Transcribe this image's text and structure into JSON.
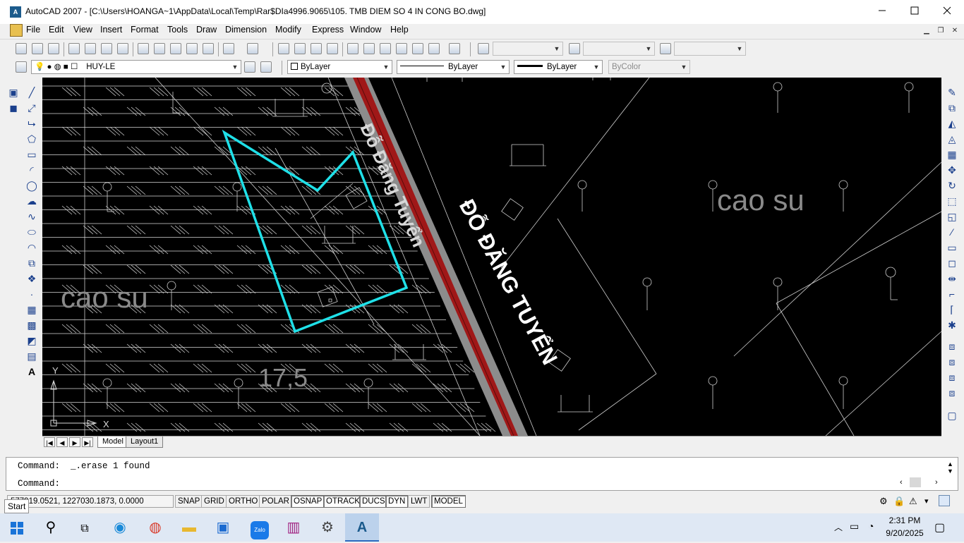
{
  "window": {
    "title": "AutoCAD 2007 - [C:\\Users\\HOANGA~1\\AppData\\Local\\Temp\\Rar$DIa4996.9065\\105. TMB DIEM SO 4 IN CONG BO.dwg]",
    "minimize_icon": "minimize-icon",
    "maximize_icon": "maximize-icon",
    "close_icon": "close-icon"
  },
  "menu": {
    "items": [
      "File",
      "Edit",
      "View",
      "Insert",
      "Format",
      "Tools",
      "Draw",
      "Dimension",
      "Modify",
      "Express",
      "Window",
      "Help"
    ]
  },
  "layers_toolbar": {
    "layer_name": "HUY-LE"
  },
  "properties_toolbar": {
    "color": "ByLayer",
    "linetype": "ByLayer",
    "lineweight": "ByLayer",
    "plotstyle": "ByColor"
  },
  "drawing": {
    "labels": {
      "cao_su_left": "cao su",
      "cao_su_right": "cao su",
      "road_name": "ĐỖ ĐĂNG TUYỂN",
      "road_name_faded": "Đỗ Đăng Tuyển",
      "dimension": "17,5"
    },
    "ucs": {
      "y": "Y",
      "x": "X"
    },
    "colors": {
      "background": "#000000",
      "parcel": "#1fe0e8",
      "road_red": "#a01818",
      "road_gray": "#8c8c8c",
      "text_gray": "#8a8a8a"
    }
  },
  "tabs": {
    "items": [
      "Model",
      "Layout1"
    ],
    "active": "Model"
  },
  "command": {
    "history": "Command:  _.erase 1 found",
    "prompt": "Command:"
  },
  "status": {
    "coordinates": "577919.0521, 1227030.1873, 0.0000",
    "toggles": [
      "SNAP",
      "GRID",
      "ORTHO",
      "POLAR",
      "OSNAP",
      "OTRACK",
      "DUCS",
      "DYN",
      "LWT",
      "MODEL"
    ],
    "on": [
      "OSNAP",
      "OTRACK",
      "DUCS",
      "DYN",
      "MODEL"
    ]
  },
  "taskbar": {
    "start_tooltip": "Start",
    "zalo_label": "Zalo",
    "time": "2:31 PM",
    "date": "9/20/2025"
  }
}
